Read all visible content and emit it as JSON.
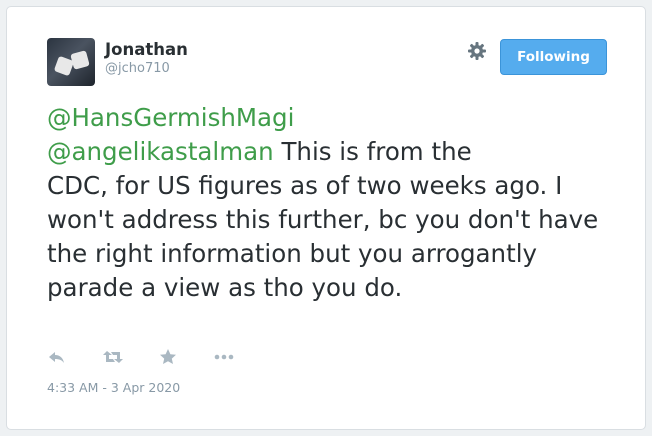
{
  "user": {
    "display_name": "Jonathan",
    "handle": "@jcho710"
  },
  "header": {
    "follow_label": "Following",
    "settings_icon": "gear-icon"
  },
  "tweet": {
    "mention_1": "@HansGermishMagi",
    "mention_2": "@angelikastalman",
    "body_line_2": " This is from the",
    "body_rest": "CDC, for US figures as of two weeks ago. I won't address this further, bc you don't have the right information but you arrogantly parade a view as tho you do."
  },
  "actions": {
    "icons": [
      "reply-icon",
      "retweet-icon",
      "favorite-icon",
      "more-icon"
    ]
  },
  "timestamp": "4:33 AM - 3 Apr 2020",
  "colors": {
    "accent": "#55acee",
    "mention": "#3f9d4a",
    "text": "#292f33",
    "muted": "#8899a6"
  }
}
